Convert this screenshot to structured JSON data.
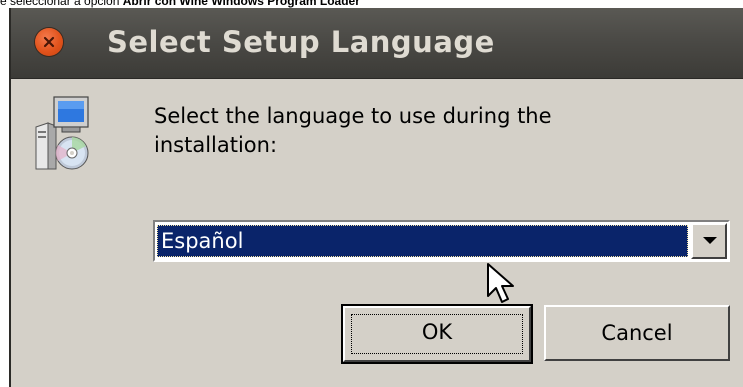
{
  "caption": {
    "prefix": "e seleccionar a opción ",
    "bold": "Abrir con Wine Windows Program Loader"
  },
  "dialog": {
    "title": "Select Setup Language",
    "close_icon": "close-icon",
    "prompt": "Select the language to use during the installation:",
    "language_select": {
      "selected": "Español",
      "highlight_color": "#0a246a"
    },
    "ok_label": "OK",
    "cancel_label": "Cancel",
    "colors": {
      "titlebar": "#3c3b37",
      "close_button": "#e2531c",
      "client_background": "#d4d0c8"
    }
  }
}
